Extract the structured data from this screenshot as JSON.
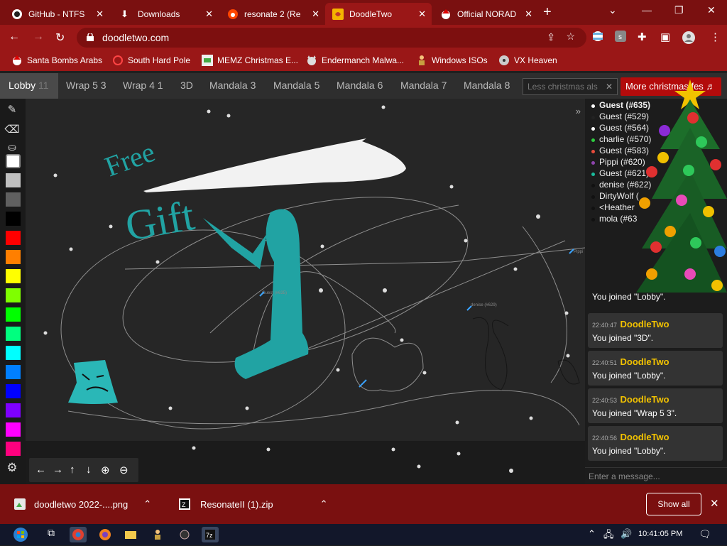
{
  "browser": {
    "tabs": [
      {
        "label": "GitHub - NTFS",
        "icon": "github-icon"
      },
      {
        "label": "Downloads",
        "icon": "download-icon"
      },
      {
        "label": "resonate 2 (Res",
        "icon": "reddit-icon"
      },
      {
        "label": "DoodleTwo",
        "icon": "doodletwo-icon",
        "active": true
      },
      {
        "label": "Official NORAD",
        "icon": "santa-icon"
      }
    ],
    "url": "doodletwo.com",
    "bookmarks": [
      {
        "label": "Santa Bombs Arabs",
        "icon": "santa-icon"
      },
      {
        "label": "South Hard Pole",
        "icon": "globe-icon"
      },
      {
        "label": "MEMZ Christmas E...",
        "icon": "image-icon"
      },
      {
        "label": "Endermanch Malwa...",
        "icon": "cat-icon"
      },
      {
        "label": "Windows ISOs",
        "icon": "figure-icon"
      },
      {
        "label": "VX Heaven",
        "icon": "dvd-icon"
      }
    ]
  },
  "app": {
    "rooms": [
      {
        "label": "Lobby",
        "count": "11",
        "selected": true
      },
      {
        "label": "Wrap 5 3"
      },
      {
        "label": "Wrap 4 1"
      },
      {
        "label": "3D"
      },
      {
        "label": "Mandala 3"
      },
      {
        "label": "Mandala 5"
      },
      {
        "label": "Mandala 6"
      },
      {
        "label": "Mandala 7"
      },
      {
        "label": "Mandala 8"
      }
    ],
    "less_placeholder": "Less christmas als",
    "more_christmas": "More christmas fes",
    "canvas_texts": {
      "free": "Free",
      "gift": "Gift",
      "cursor1": "Guest (#635)",
      "cursor2": "denise (#629)",
      "cursor3": "Pippi"
    },
    "palette": [
      "#ffffff",
      "#c0c0c0",
      "#606060",
      "#000000",
      "#ff0000",
      "#ff7f00",
      "#ffff00",
      "#7fff00",
      "#00ff00",
      "#00ff7f",
      "#00ffff",
      "#007fff",
      "#0000ff",
      "#7f00ff",
      "#ff00ff",
      "#ff007f"
    ],
    "users": [
      {
        "name": "Guest (#635)",
        "color": "#ffffff",
        "bold": true
      },
      {
        "name": "Guest (#529)",
        "color": "#222222"
      },
      {
        "name": "Guest (#564)",
        "color": "#ffffff"
      },
      {
        "name": "charlie (#570)",
        "color": "#2ecc40"
      },
      {
        "name": "Guest (#583)",
        "color": "#e74c3c"
      },
      {
        "name": "Pippi (#620)",
        "color": "#8e44ad"
      },
      {
        "name": "Guest (#621)",
        "color": "#1abc9c"
      },
      {
        "name": "denise (#622)",
        "color": "#111111"
      },
      {
        "name": "DirtyWolf (",
        "color": "#111111"
      },
      {
        "name": "<Heather",
        "color": "#111111"
      },
      {
        "name": "mola (#63",
        "color": "#111111"
      }
    ],
    "joined_partial": "You joined \"Lobby\".",
    "messages": [
      {
        "time": "22:40:47",
        "who": "DoodleTwo",
        "text": "You joined \"3D\"."
      },
      {
        "time": "22:40:51",
        "who": "DoodleTwo",
        "text": "You joined \"Lobby\"."
      },
      {
        "time": "22:40:53",
        "who": "DoodleTwo",
        "text": "You joined \"Wrap 5 3\"."
      },
      {
        "time": "22:40:56",
        "who": "DoodleTwo",
        "text": "You joined \"Lobby\"."
      }
    ],
    "chat_placeholder": "Enter a message..."
  },
  "downloads": [
    {
      "name": "doodletwo 2022-....png",
      "icon": "image-file-icon"
    },
    {
      "name": "ResonateII (1).zip",
      "icon": "zip-file-icon"
    }
  ],
  "show_all": "Show all",
  "taskbar": {
    "time": "10:41:05 PM"
  },
  "colors": {
    "tabbar": "#7a1010",
    "toolbar": "#9a1717",
    "accent": "#f2c200",
    "teal": "#21a3a3"
  }
}
